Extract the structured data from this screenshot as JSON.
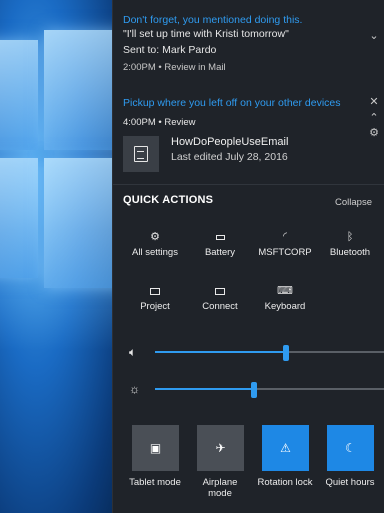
{
  "notifications": [
    {
      "title": "Don't forget, you mentioned doing this.",
      "body": "\"I'll set up time with Kristi tomorrow\"",
      "sent_to": "Sent to: Mark Pardo",
      "meta": "2:00PM  •  Review in Mail"
    }
  ],
  "pickup": {
    "title": "Pickup where you left off on your other devices",
    "meta": "4:00PM  •  Review",
    "file_name": "HowDoPeopleUseEmail",
    "last_edited": "Last edited July 28, 2016"
  },
  "quick_actions": {
    "header": "QUICK ACTIONS",
    "collapse": "Collapse",
    "items": [
      {
        "label": "All settings",
        "icon": "settings-icon"
      },
      {
        "label": "Battery",
        "icon": "battery-icon"
      },
      {
        "label": "MSFTCORP",
        "icon": "wifi-icon"
      },
      {
        "label": "Bluetooth",
        "icon": "bluetooth-icon"
      },
      {
        "label": "Project",
        "icon": "project-icon"
      },
      {
        "label": "Connect",
        "icon": "connect-icon"
      },
      {
        "label": "Keyboard",
        "icon": "keyboard-icon"
      }
    ]
  },
  "sliders": {
    "volume": {
      "icon": "volume-icon",
      "value": 0.57
    },
    "brightness": {
      "icon": "brightness-icon",
      "value": 0.43
    }
  },
  "tiles": [
    {
      "label": "Tablet mode",
      "state": "off",
      "icon": "tablet-mode-icon"
    },
    {
      "label": "Airplane mode",
      "state": "off",
      "icon": "airplane-icon"
    },
    {
      "label": "Rotation lock",
      "state": "on",
      "icon": "rotation-lock-icon"
    },
    {
      "label": "Quiet hours",
      "state": "on",
      "icon": "quiet-hours-icon"
    }
  ],
  "colors": {
    "accent": "#2f9bf0",
    "tile_on": "#1e88e5",
    "tile_off": "#4a4f56",
    "panel": "#1f2329"
  }
}
